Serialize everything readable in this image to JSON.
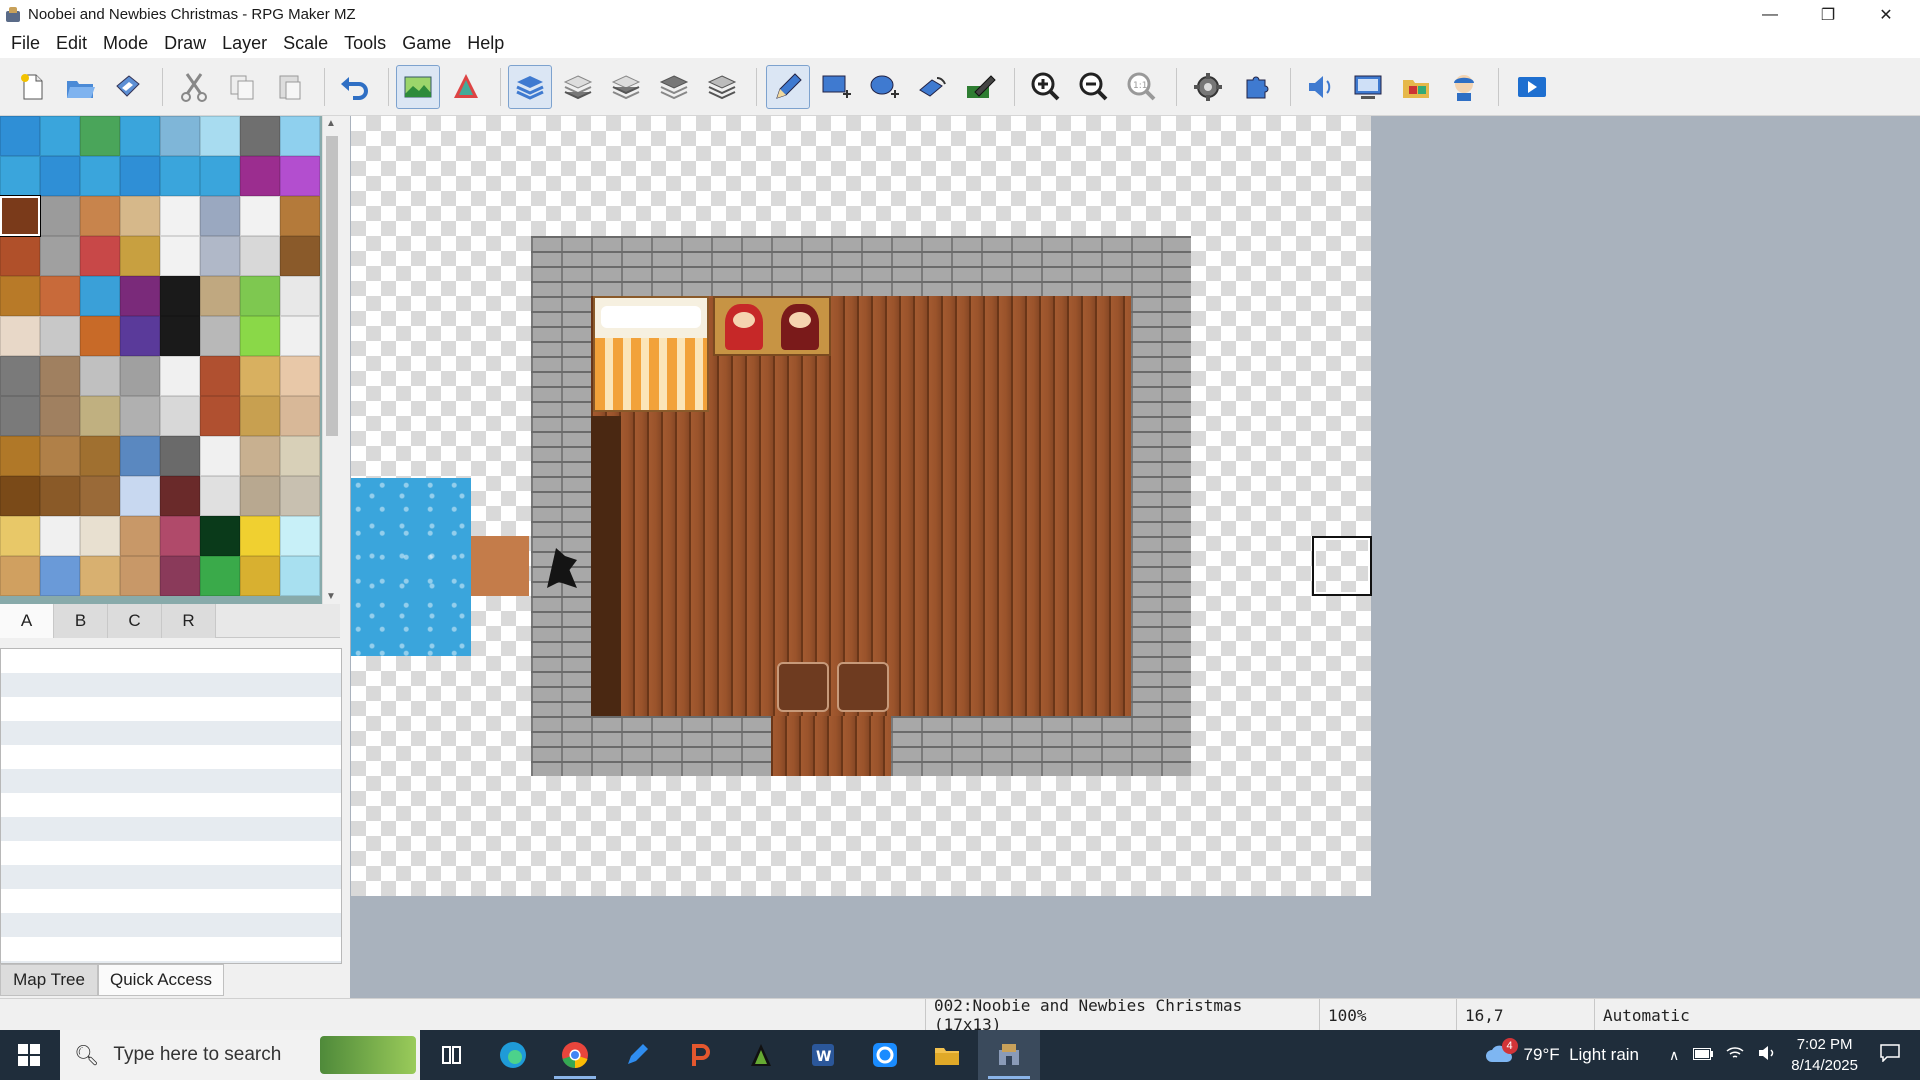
{
  "window": {
    "title": "Noobei and Newbies Christmas - RPG Maker MZ",
    "controls": [
      "minimize-icon",
      "restore-icon",
      "close-icon"
    ]
  },
  "menu": [
    "File",
    "Edit",
    "Mode",
    "Draw",
    "Layer",
    "Scale",
    "Tools",
    "Game",
    "Help"
  ],
  "toolbar": {
    "buttons": [
      "new-project-icon",
      "open-project-icon",
      "save-project-icon",
      "cut-icon",
      "copy-icon",
      "paste-icon",
      "undo-icon",
      "map-mode-icon",
      "event-mode-icon",
      "layer-auto-icon",
      "layer-1-icon",
      "layer-2-icon",
      "layer-3-icon",
      "layer-4-icon",
      "pencil-icon",
      "rectangle-icon",
      "ellipse-icon",
      "fill-icon",
      "shadow-pen-icon",
      "zoom-in-icon",
      "zoom-out-icon",
      "actual-size-icon",
      "database-icon",
      "plugin-manager-icon",
      "sound-test-icon",
      "event-searcher-icon",
      "resource-manager-icon",
      "character-generator-icon",
      "playtest-icon"
    ]
  },
  "tile_tabs": [
    "A",
    "B",
    "C",
    "R"
  ],
  "tile_tabs_active": "A",
  "left_tabs": [
    "Map Tree",
    "Quick Access"
  ],
  "status": {
    "map": "002:Noobie and Newbies Christmas (17x13)",
    "zoom": "100%",
    "coords": "16,7",
    "mode": "Automatic"
  },
  "taskbar": {
    "search_placeholder": "Type here to search",
    "weather_badge": "4",
    "weather": "79°F  Light rain",
    "time": "7:02 PM",
    "date": "8/14/2025"
  },
  "colors": {
    "floor": "#8f4f2a",
    "stone": "#a8a8a8",
    "water": "#3aa5dc",
    "active_tab_accent": "#7da2ce"
  }
}
